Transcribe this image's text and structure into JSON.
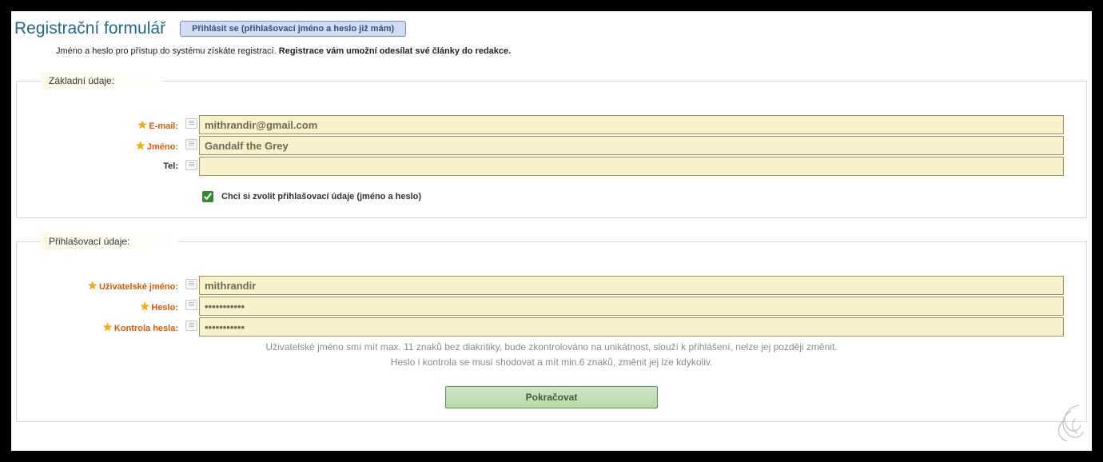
{
  "header": {
    "title": "Registrační formulář",
    "login_button": "Přihlásit se (přihlašovací jméno a heslo již mám)"
  },
  "intro": {
    "lead": "Jméno a heslo pro přístup do systému získáte registrací. ",
    "bold": "Registrace vám umožní odesílat své články do redakce."
  },
  "basic": {
    "legend": "Základní údaje:",
    "email_label": "E-mail:",
    "email_value": "mithrandir@gmail.com",
    "name_label": "Jméno:",
    "name_value": "Gandalf the Grey",
    "tel_label": "Tel:",
    "tel_value": "",
    "choose_login_label": "Chci si zvolit přihlašovací údaje (jméno a heslo)",
    "choose_login_checked": true
  },
  "login": {
    "legend": "Přihlašovací údaje:",
    "user_label": "Uživatelské jméno:",
    "user_value": "mithrandir",
    "pass_label": "Heslo:",
    "pass_value": "•••••••••••",
    "pass2_label": "Kontrola hesla:",
    "pass2_value": "•••••••••••",
    "hint1": "Uživatelské jméno smí mít max. 11 znaků bez diakritiky, bude zkontrolováno na unikátnost, slouží k přihlášení, nelze jej později změnit.",
    "hint2": "Heslo i kontrola se musí shodovat a mít min.6 znaků, změnit jej lze kdykoliv."
  },
  "actions": {
    "continue": "Pokračovat"
  }
}
